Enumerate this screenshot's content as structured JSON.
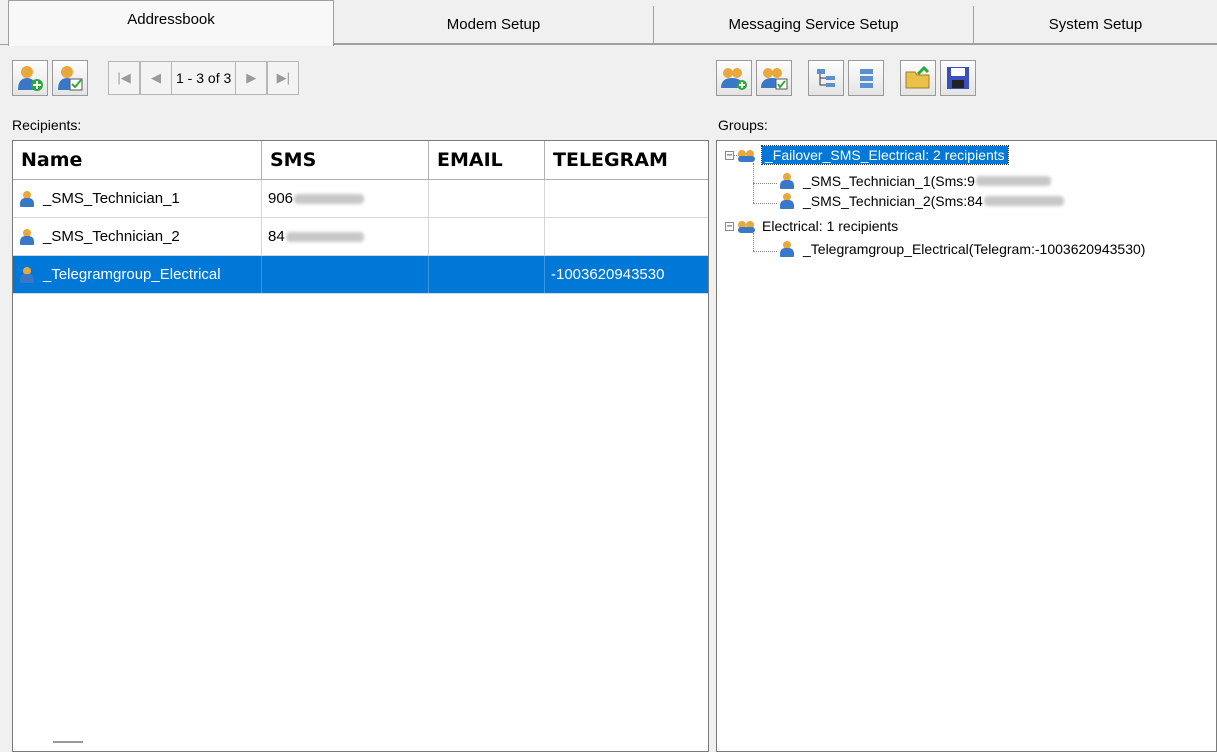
{
  "tabs": [
    {
      "label": "Addressbook"
    },
    {
      "label": "Modem Setup"
    },
    {
      "label": "Messaging Service Setup"
    },
    {
      "label": "System Setup"
    }
  ],
  "pager": {
    "text": "1 - 3 of 3"
  },
  "recipients": {
    "label": "Recipients:",
    "columns": [
      "Name",
      "SMS",
      "EMAIL",
      "TELEGRAM"
    ],
    "rows": [
      {
        "name": "_SMS_Technician_1",
        "sms": "906",
        "email": "",
        "telegram": ""
      },
      {
        "name": "_SMS_Technician_2",
        "sms": "84",
        "email": "",
        "telegram": ""
      },
      {
        "name": "_Telegramgroup_Electrical",
        "sms": "",
        "email": "",
        "telegram": "-1003620943530",
        "selected": true
      }
    ]
  },
  "groups": {
    "label": "Groups:",
    "tree": [
      {
        "label": "_Failover_SMS_Electrical: 2 recipients",
        "children": [
          {
            "label": "_SMS_Technician_1(Sms:9"
          },
          {
            "label": "_SMS_Technician_2(Sms:84"
          }
        ]
      },
      {
        "label": "Electrical: 1 recipients",
        "children": [
          {
            "label": "_Telegramgroup_Electrical(Telegram:-1003620943530)"
          }
        ]
      }
    ]
  },
  "icons": {
    "add_recipient": "add-user-icon",
    "edit_recipient": "edit-user-icon",
    "first": "first-page-icon",
    "prev": "prev-page-icon",
    "next": "next-page-icon",
    "last": "last-page-icon",
    "add_group": "add-group-icon",
    "edit_group": "edit-group-icon",
    "expand": "expand-tree-icon",
    "collapse": "collapse-tree-icon",
    "open": "open-folder-icon",
    "save": "save-icon"
  },
  "colors": {
    "selection": "#0078d7"
  }
}
